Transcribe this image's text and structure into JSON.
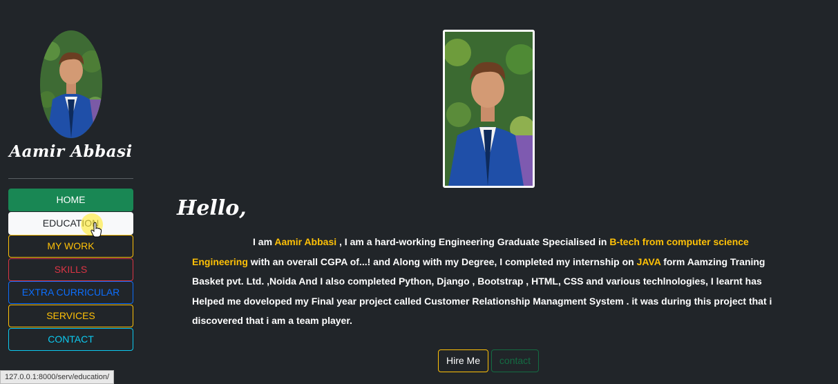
{
  "sidebar": {
    "brand": "Aamir Abbasi",
    "nav": [
      {
        "label": "HOME"
      },
      {
        "label": "EDUCATION"
      },
      {
        "label": "MY WORK"
      },
      {
        "label": "SKILLS"
      },
      {
        "label": "EXTRA CURRICULAR"
      },
      {
        "label": "SERVICES"
      },
      {
        "label": "CONTACT"
      }
    ]
  },
  "main": {
    "greeting": "Hello,",
    "bio": {
      "p1": "I am ",
      "name": "Aamir Abbasi",
      "p2": " , I am a hard-working Engineering Graduate Specialised in ",
      "degree": "B-tech from computer science Engineering",
      "p3": " with an overall CGPA of...! and Along with my Degree, I completed my internship on ",
      "tech": "JAVA",
      "p4": " form Aamzing Traning Basket pvt. Ltd. ,Noida And I also completed Python, Django , Bootstrap , HTML, CSS and various techlnologies, I learnt has Helped me doveloped my Final year project called Customer Relationship Managment System . it was during this project that i discovered that i am a team player."
    },
    "hire_label": "Hire Me",
    "contact_label": "contact"
  },
  "status_url": "127.0.0.1:8000/serv/education/",
  "colors": {
    "background": "#212529",
    "accent_yellow": "#ffc107",
    "home_green": "#198754",
    "skills_red": "#dc3545",
    "extra_blue": "#0d6efd",
    "contact_cyan": "#0dcaf0"
  },
  "icons": {
    "cursor": "hand-pointer-icon"
  }
}
